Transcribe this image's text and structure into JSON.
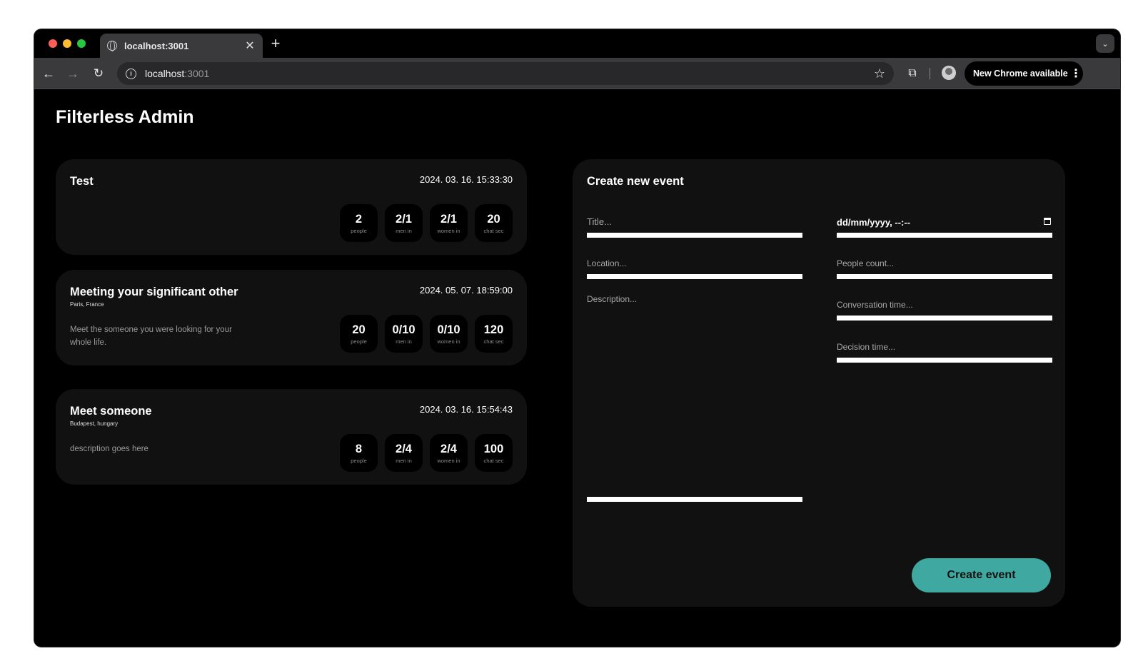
{
  "browser": {
    "tab_title": "localhost:3001",
    "tab_close": "✕",
    "new_tab": "+",
    "tab_menu": "⌄",
    "nav_back": "←",
    "nav_forward": "→",
    "nav_reload": "↻",
    "url_host": "localhost",
    "url_port": ":3001",
    "star": "☆",
    "extensions": "⧉",
    "update_label": "New Chrome available",
    "update_menu": "⋮"
  },
  "page": {
    "title": "Filterless Admin"
  },
  "events": [
    {
      "name": "Test",
      "location": "",
      "date": "2024. 03. 16. 15:33:30",
      "description": "",
      "stats": [
        {
          "value": "2",
          "label": "people"
        },
        {
          "value": "2/1",
          "label": "men in"
        },
        {
          "value": "2/1",
          "label": "women in"
        },
        {
          "value": "20",
          "label": "chat sec"
        }
      ]
    },
    {
      "name": "Meeting your significant other",
      "location": "Paris, France",
      "date": "2024. 05. 07. 18:59:00",
      "description": "Meet the someone you were looking for your whole life.",
      "stats": [
        {
          "value": "20",
          "label": "people"
        },
        {
          "value": "0/10",
          "label": "men in"
        },
        {
          "value": "0/10",
          "label": "women in"
        },
        {
          "value": "120",
          "label": "chat sec"
        }
      ]
    },
    {
      "name": "Meet someone",
      "location": "Budapest, hungary",
      "date": "2024. 03. 16. 15:54:43",
      "description": "description goes here",
      "stats": [
        {
          "value": "8",
          "label": "people"
        },
        {
          "value": "2/4",
          "label": "men in"
        },
        {
          "value": "2/4",
          "label": "women in"
        },
        {
          "value": "100",
          "label": "chat sec"
        }
      ]
    }
  ],
  "create_form": {
    "title": "Create new event",
    "title_placeholder": "Title...",
    "location_placeholder": "Location...",
    "description_placeholder": "Description...",
    "date_placeholder": "dd/mm/yyyy, --:--",
    "people_placeholder": "People count...",
    "conversation_placeholder": "Conversation time...",
    "decision_placeholder": "Decision time...",
    "submit_label": "Create event"
  }
}
